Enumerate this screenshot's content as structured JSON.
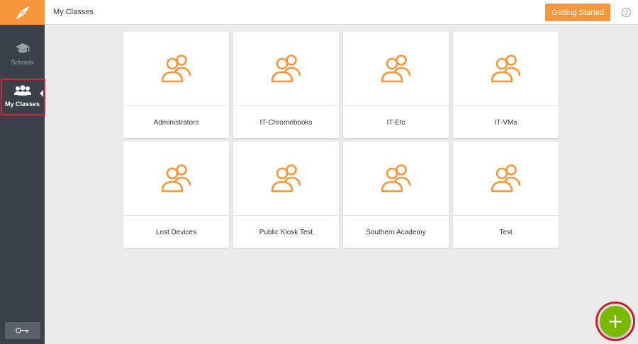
{
  "sidebar": {
    "logo_icon": "compass-logo-icon",
    "items": [
      {
        "label": "Schools",
        "icon": "graduation-cap-icon"
      },
      {
        "label": "My Classes",
        "icon": "users-group-icon",
        "active": true
      }
    ],
    "logout_icon": "key-icon"
  },
  "header": {
    "title": "My Classes",
    "getting_started_label": "Getting Started",
    "help_glyph": "?"
  },
  "classes": [
    {
      "label": "Administrators"
    },
    {
      "label": "IT-Chromebooks"
    },
    {
      "label": "IT-Etc"
    },
    {
      "label": "IT-VMs"
    },
    {
      "label": "Lost Devices"
    },
    {
      "label": "Public Kiosk Test"
    },
    {
      "label": "Southern Academy"
    },
    {
      "label": "Test"
    }
  ],
  "fab": {
    "label": "+"
  },
  "colors": {
    "accent": "#f7963b",
    "sidebar": "#3a4149",
    "fab": "#7ab800",
    "highlight": "#d9232d"
  }
}
